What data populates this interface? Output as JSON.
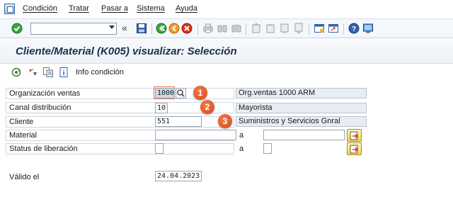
{
  "menu": {
    "items": [
      "Condición",
      "Tratar",
      "Pasar a",
      "Sistema",
      "Ayuda"
    ]
  },
  "toolbar": {
    "command_field_value": "",
    "chevron": "«"
  },
  "title": "Cliente/Material (K005) visualizar: Selección",
  "app_toolbar": {
    "info_label": "Info condición"
  },
  "form": {
    "org_ventas": {
      "label": "Organización ventas",
      "value": "1000",
      "description": "Org.ventas 1000 ARM"
    },
    "canal": {
      "label": "Canal distribución",
      "value": "10",
      "description": "Mayorista"
    },
    "cliente": {
      "label": "Cliente",
      "value": "551",
      "description": "Suministros y Servicios Gnral"
    },
    "material": {
      "label": "Material",
      "value_from": "",
      "to_label": "a",
      "value_to": ""
    },
    "status": {
      "label": "Status de liberación",
      "value_from": "",
      "to_label": "a",
      "value_to": ""
    },
    "valido": {
      "label": "Válido el",
      "value": "24.04.2023"
    }
  },
  "badges": [
    "1",
    "2",
    "3"
  ],
  "colors": {
    "badge": "#d8481a",
    "title": "#1d2f4a",
    "toolbar_bg": "#f4f7fb"
  }
}
